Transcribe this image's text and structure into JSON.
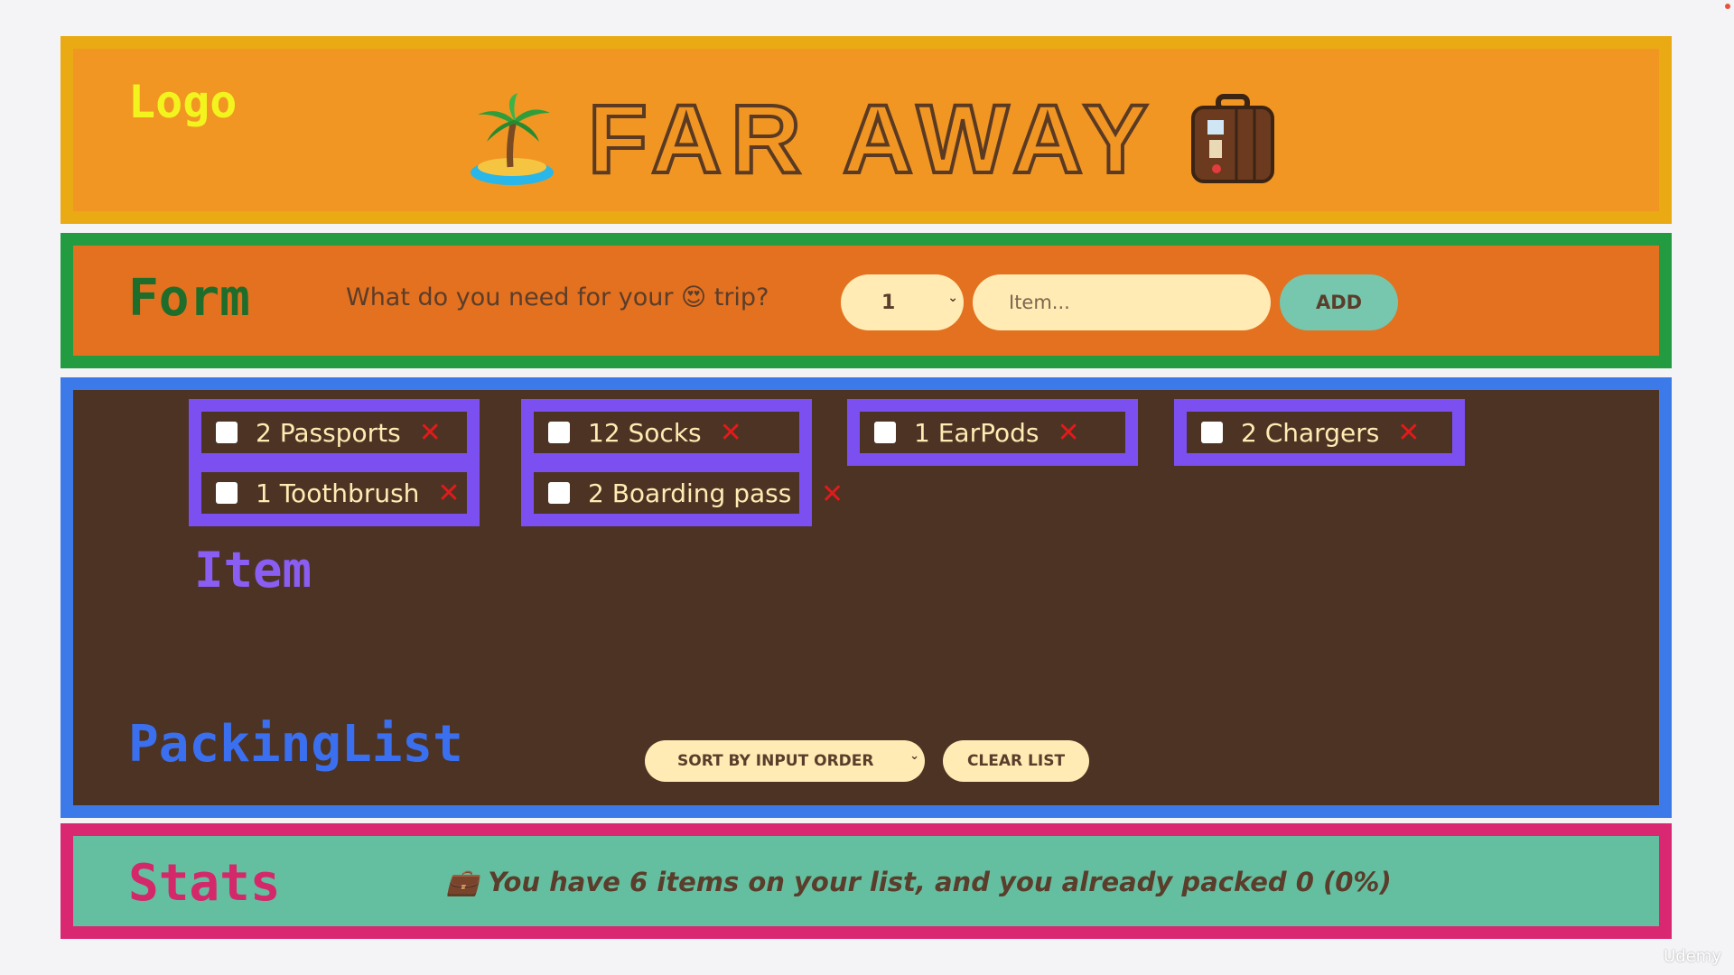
{
  "logo": {
    "label": "Logo",
    "title": "FAR AWAY",
    "left_icon": "palm-island-icon",
    "right_icon": "suitcase-icon"
  },
  "form": {
    "label": "Form",
    "question": "What do you need for your 😍 trip?",
    "quantity_value": "1",
    "item_placeholder": "Item...",
    "add_label": "ADD"
  },
  "packing_list": {
    "label": "PackingList",
    "item_label": "Item",
    "items": [
      {
        "text": "2 Passports",
        "packed": false
      },
      {
        "text": "12 Socks",
        "packed": false
      },
      {
        "text": "1 EarPods",
        "packed": false
      },
      {
        "text": "2 Chargers",
        "packed": false
      },
      {
        "text": "1 Toothbrush",
        "packed": false
      },
      {
        "text": "2 Boarding pass",
        "packed": false
      }
    ],
    "delete_glyph": "✕",
    "sort_label": "SORT BY INPUT ORDER",
    "clear_label": "CLEAR LIST"
  },
  "stats": {
    "label": "Stats",
    "text": "💼 You have 6 items on your list, and you already packed 0 (0%)"
  },
  "watermark": "Udemy",
  "colors": {
    "logo_border": "#e9aa13",
    "logo_bg": "#f19623",
    "form_border": "#239b40",
    "form_bg": "#e3711f",
    "list_border": "#3b7ae8",
    "list_bg": "#4d3324",
    "item_border": "#7c4ff0",
    "stats_border": "#da2772",
    "stats_bg": "#64bfa1",
    "delete": "#e11b1b",
    "pill": "#ffebb3",
    "add_button": "#76c7ad"
  }
}
